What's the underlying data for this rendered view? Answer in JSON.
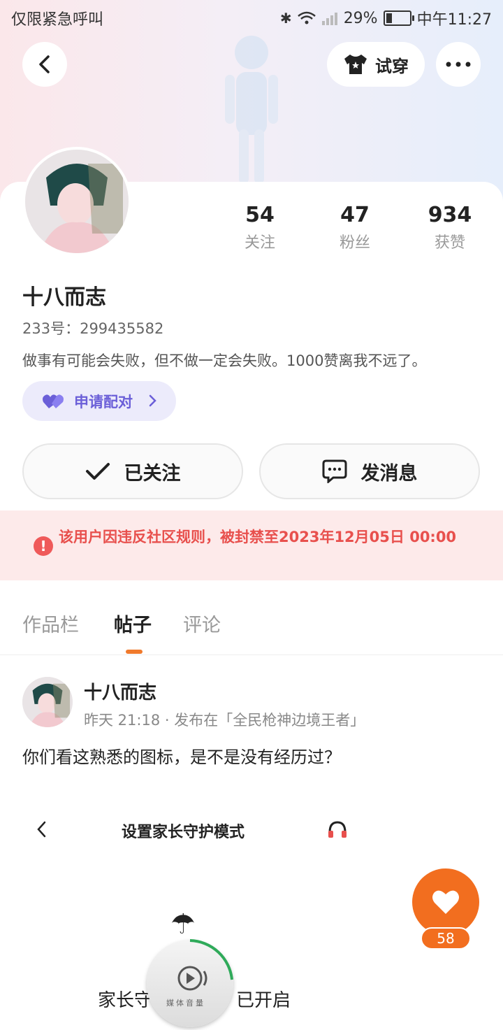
{
  "status_bar": {
    "left_text": "仅限紧急呼叫",
    "battery": "29%",
    "battery_level": 0.29,
    "time": "中午11:27"
  },
  "header": {
    "tryon_label": "试穿"
  },
  "profile": {
    "name": "十八而志",
    "uid_line": "233号：299435582",
    "bio": "做事有可能会失败，但不做一定会失败。1000赞离我不远了。",
    "stats": [
      {
        "value": "54",
        "label": "关注"
      },
      {
        "value": "47",
        "label": "粉丝"
      },
      {
        "value": "934",
        "label": "获赞"
      }
    ],
    "pair_label": "申请配对",
    "follow_label": "已关注",
    "message_label": "发消息"
  },
  "ban_notice": "该用户因违反社区规则，被封禁至2023年12月05日 00:00",
  "tabs": [
    {
      "label": "作品栏",
      "active": false
    },
    {
      "label": "帖子",
      "active": true
    },
    {
      "label": "评论",
      "active": false
    }
  ],
  "post": {
    "author": "十八而志",
    "meta": "昨天 21:18 · 发布在「全民枪神边境王者」",
    "text": "你们看这熟悉的图标，是不是没有经历过？",
    "embed": {
      "title": "设置家长守护模式",
      "status_left": "家长守",
      "status_right": "已开启",
      "media_label": "媒体音量"
    }
  },
  "like": {
    "count": "58"
  },
  "colors": {
    "accent_orange": "#f26e1f",
    "ban_red": "#e8504d",
    "pair_purple": "#6b5fd8"
  }
}
